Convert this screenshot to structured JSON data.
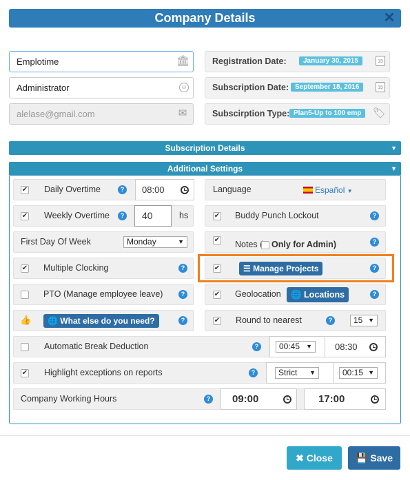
{
  "title": "Company Details",
  "company": {
    "name": "Emplotime",
    "role": "Administrator",
    "email_placeholder": "alelase@gmail.com"
  },
  "dates": {
    "registration_label": "Registration Date:",
    "registration_value": "January 30, 2015",
    "subscription_label": "Subscription Date:",
    "subscription_value": "September 18, 2016",
    "type_label": "Subscirption Type:",
    "type_value": "Plan5-Up to 100 emp",
    "cal_day": "15"
  },
  "bars": {
    "subscription": "Subscription Details",
    "additional": "Additional Settings"
  },
  "settings": {
    "daily_overtime": "Daily Overtime",
    "daily_time": "08:00",
    "weekly_overtime": "Weekly Overtime",
    "weekly_value": "40",
    "weekly_unit": "hs",
    "first_day": "First Day Of Week",
    "first_day_value": "Monday",
    "multiple_clocking": "Multiple Clocking",
    "pto": "PTO (Manage employee leave)",
    "what_else": "What else do you need?",
    "auto_break": "Automatic Break Deduction",
    "auto_break_duration": "00:45",
    "auto_break_time": "08:30",
    "highlight": "Highlight exceptions on reports",
    "highlight_mode": "Strict",
    "highlight_time": "00:15",
    "working_hours": "Company Working Hours",
    "wh_start": "09:00",
    "wh_end": "17:00",
    "language": "Language",
    "language_value": "Español",
    "buddy": "Buddy Punch Lockout",
    "notes": "Notes (",
    "notes_admin": "Only for Admin)",
    "manage_projects": "Manage Projects",
    "geolocation": "Geolocation",
    "locations": "Locations",
    "round": "Round to nearest",
    "round_value": "15"
  },
  "buttons": {
    "close": "Close",
    "save": "Save"
  }
}
